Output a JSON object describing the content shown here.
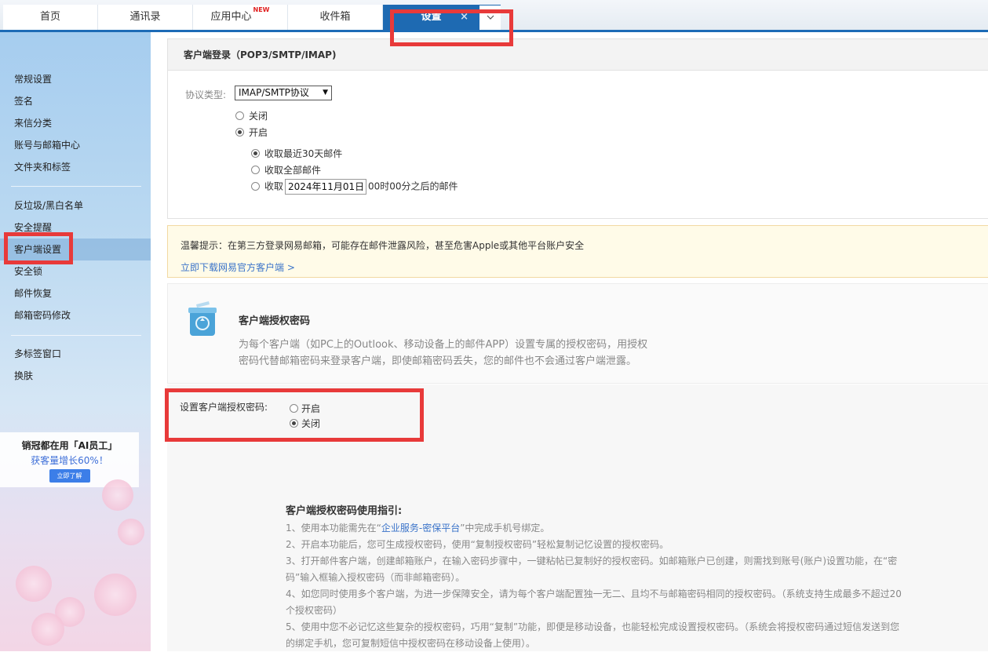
{
  "topbar": {
    "tabs": [
      {
        "label": "首页"
      },
      {
        "label": "通讯录"
      },
      {
        "label": "应用中心",
        "badge": "NEW"
      },
      {
        "label": "收件箱"
      },
      {
        "label": "设置",
        "close": "×"
      }
    ],
    "more_icon": "chevron-down-icon"
  },
  "sidebar": {
    "items": [
      {
        "label": "常规设置"
      },
      {
        "label": "签名"
      },
      {
        "label": "来信分类"
      },
      {
        "label": "账号与邮箱中心"
      },
      {
        "label": "文件夹和标签"
      },
      {
        "label": "反垃圾/黑白名单"
      },
      {
        "label": "安全提醒"
      },
      {
        "label": "客户端设置"
      },
      {
        "label": "安全锁"
      },
      {
        "label": "邮件恢复"
      },
      {
        "label": "邮箱密码修改"
      },
      {
        "label": "多标签窗口"
      },
      {
        "label": "换肤"
      }
    ],
    "active": "客户端设置",
    "ad": {
      "title": "销冠都在用「AI员工」",
      "subtitle": "获客量增长60%！",
      "button": "立即了解"
    }
  },
  "client_login": {
    "title": "客户端登录（POP3/SMTP/IMAP)",
    "protocol_label": "协议类型:",
    "protocol_value": "IMAP/SMTP协议",
    "off_label": "关闭",
    "on_label": "开启",
    "opt_30days": "收取最近30天邮件",
    "opt_all": "收取全部邮件",
    "opt_since_prefix": "收取",
    "opt_since_date": "2024年11月01日",
    "opt_since_suffix": "00时00分之后的邮件"
  },
  "warning": {
    "text": "温馨提示：在第三方登录网易邮箱，可能存在邮件泄露风险，甚至危害Apple或其他平台账户安全",
    "link": "立即下载网易官方客户端 >"
  },
  "auth_password": {
    "icon": "recycle-bin-icon",
    "title": "客户端授权密码",
    "desc_line1": "为每个客户端（如PC上的Outlook、移动设备上的邮件APP）设置专属的授权密码，用授权",
    "desc_line2": "密码代替邮箱密码来登录客户端，即使邮箱密码丢失，您的邮件也不会通过客户端泄露。",
    "setting_label": "设置客户端授权密码:",
    "on_label": "开启",
    "off_label": "关闭"
  },
  "guide": {
    "title": "客户端授权密码使用指引:",
    "item1_prefix": "1、使用本功能需先在“",
    "item1_link": "企业服务-密保平台",
    "item1_suffix": "”中完成手机号绑定。",
    "item2": "2、开启本功能后，您可生成授权密码，使用“复制授权密码”轻松复制记忆设置的授权密码。",
    "item3a": "3、打开邮件客户端，创建邮箱账户，在输入密码步骤中，一键粘帖已复制好的授权密码。如邮箱账户已创建，则需找到账号(账户)设置功能，在“密",
    "item3b": "码”输入框输入授权密码（而非邮箱密码）。",
    "item4a": "4、如您同时使用多个客户端，为进一步保障安全，请为每个客户端配置独一无二、且均不与邮箱密码相同的授权密码。（系统支持生成最多不超过20",
    "item4b": "个授权密码）",
    "item5a": "5、使用中您不必记忆这些复杂的授权密码，巧用“复制”功能，即便是移动设备，也能轻松完成设置授权密码。（系统会将授权密码通过短信发送到您",
    "item5b": "的绑定手机，您可复制短信中授权密码在移动设备上使用）。"
  },
  "colors": {
    "accent": "#1e6ab2",
    "highlight": "#e83a3a",
    "link": "#3a73c9"
  }
}
